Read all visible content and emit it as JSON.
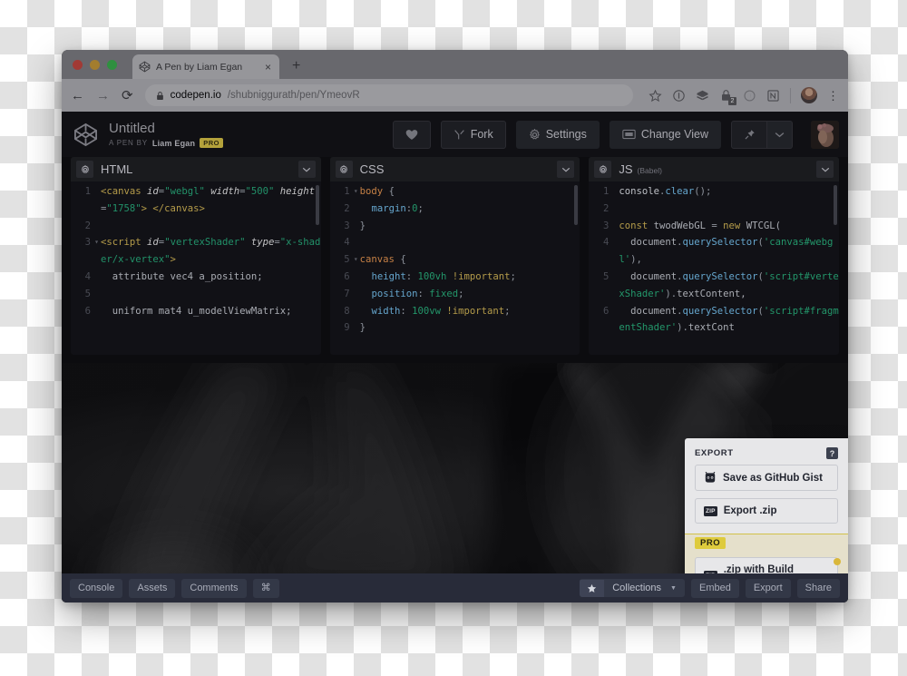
{
  "browser": {
    "tab": {
      "title": "A Pen by Liam Egan",
      "favicon": "codepen-icon",
      "close": "×"
    },
    "new_tab": "+",
    "nav": {
      "back": "←",
      "forward": "→",
      "reload": "⟳"
    },
    "address": {
      "host": "codepen.io",
      "path": "/shubniggurath/pen/YmeovR",
      "lock": "lock-icon"
    },
    "toolbar_icons": [
      "star-icon",
      "info-icon",
      "layers-icon",
      "lastpass-icon",
      "moon-icon",
      "notion-icon"
    ],
    "extension_badge": "2",
    "kebab": "⋮"
  },
  "pen": {
    "logo": "codepen-logo",
    "title": "Untitled",
    "byline": "A PEN BY",
    "author": "Liam Egan",
    "pro_tag": "PRO",
    "actions": {
      "love": "♥",
      "fork": "Fork",
      "settings": "Settings",
      "change_view": "Change View",
      "pin": "pin-icon",
      "pin_caret": "⌄"
    }
  },
  "editors": [
    {
      "name": "HTML",
      "preprocessor": "",
      "gear": "gear-icon",
      "caret": "⌄",
      "lines": [
        {
          "num": "1",
          "fold": false,
          "parts": [
            {
              "t": "tag",
              "s": "<canvas "
            },
            {
              "t": "attr",
              "s": "id"
            },
            {
              "t": "punc",
              "s": "="
            },
            {
              "t": "str",
              "s": "\"webgl\""
            },
            {
              "t": "plain",
              "s": " "
            },
            {
              "t": "attr",
              "s": "width"
            },
            {
              "t": "punc",
              "s": "="
            },
            {
              "t": "str",
              "s": "\"500\""
            },
            {
              "t": "plain",
              "s": " "
            },
            {
              "t": "attr",
              "s": "height"
            },
            {
              "t": "punc",
              "s": "="
            },
            {
              "t": "str",
              "s": "\"1758\""
            },
            {
              "t": "tag",
              "s": "> </canvas>"
            }
          ]
        },
        {
          "num": "2",
          "fold": false,
          "parts": []
        },
        {
          "num": "3",
          "fold": true,
          "parts": [
            {
              "t": "tag",
              "s": "<script "
            },
            {
              "t": "attr",
              "s": "id"
            },
            {
              "t": "punc",
              "s": "="
            },
            {
              "t": "str",
              "s": "\"vertexShader\""
            },
            {
              "t": "plain",
              "s": " "
            },
            {
              "t": "attr",
              "s": "type"
            },
            {
              "t": "punc",
              "s": "="
            },
            {
              "t": "str",
              "s": "\"x-shader/x-vertex\""
            },
            {
              "t": "tag",
              "s": ">"
            }
          ]
        },
        {
          "num": "4",
          "fold": false,
          "parts": [
            {
              "t": "plain",
              "s": "  attribute vec4 a_position;"
            }
          ]
        },
        {
          "num": "5",
          "fold": false,
          "parts": []
        },
        {
          "num": "6",
          "fold": false,
          "parts": [
            {
              "t": "plain",
              "s": "  uniform mat4 u_modelViewMatrix;"
            }
          ]
        }
      ]
    },
    {
      "name": "CSS",
      "preprocessor": "",
      "gear": "gear-icon",
      "caret": "⌄",
      "lines": [
        {
          "num": "1",
          "fold": true,
          "parts": [
            {
              "t": "sel",
              "s": "body"
            },
            {
              "t": "punc",
              "s": " {"
            }
          ]
        },
        {
          "num": "2",
          "fold": false,
          "parts": [
            {
              "t": "prop",
              "s": "  margin"
            },
            {
              "t": "punc",
              "s": ":"
            },
            {
              "t": "val",
              "s": "0"
            },
            {
              "t": "punc",
              "s": ";"
            }
          ]
        },
        {
          "num": "3",
          "fold": false,
          "parts": [
            {
              "t": "punc",
              "s": "}"
            }
          ]
        },
        {
          "num": "4",
          "fold": false,
          "parts": []
        },
        {
          "num": "5",
          "fold": true,
          "parts": [
            {
              "t": "sel",
              "s": "canvas"
            },
            {
              "t": "punc",
              "s": " {"
            }
          ]
        },
        {
          "num": "6",
          "fold": false,
          "parts": [
            {
              "t": "prop",
              "s": "  height"
            },
            {
              "t": "punc",
              "s": ": "
            },
            {
              "t": "val",
              "s": "100vh"
            },
            {
              "t": "plain",
              "s": " "
            },
            {
              "t": "imp",
              "s": "!important"
            },
            {
              "t": "punc",
              "s": ";"
            }
          ]
        },
        {
          "num": "7",
          "fold": false,
          "parts": [
            {
              "t": "prop",
              "s": "  position"
            },
            {
              "t": "punc",
              "s": ": "
            },
            {
              "t": "val",
              "s": "fixed"
            },
            {
              "t": "punc",
              "s": ";"
            }
          ]
        },
        {
          "num": "8",
          "fold": false,
          "parts": [
            {
              "t": "prop",
              "s": "  width"
            },
            {
              "t": "punc",
              "s": ": "
            },
            {
              "t": "val",
              "s": "100vw"
            },
            {
              "t": "plain",
              "s": " "
            },
            {
              "t": "imp",
              "s": "!important"
            },
            {
              "t": "punc",
              "s": ";"
            }
          ]
        },
        {
          "num": "9",
          "fold": false,
          "parts": [
            {
              "t": "punc",
              "s": "}"
            }
          ]
        }
      ]
    },
    {
      "name": "JS",
      "preprocessor": "(Babel)",
      "gear": "gear-icon",
      "caret": "⌄",
      "lines": [
        {
          "num": "1",
          "fold": false,
          "parts": [
            {
              "t": "var",
              "s": "console"
            },
            {
              "t": "punc",
              "s": "."
            },
            {
              "t": "fn",
              "s": "clear"
            },
            {
              "t": "punc",
              "s": "();"
            }
          ]
        },
        {
          "num": "2",
          "fold": false,
          "parts": []
        },
        {
          "num": "3",
          "fold": false,
          "parts": [
            {
              "t": "kw",
              "s": "const"
            },
            {
              "t": "plain",
              "s": " twodWebGL "
            },
            {
              "t": "punc",
              "s": "= "
            },
            {
              "t": "kw",
              "s": "new"
            },
            {
              "t": "plain",
              "s": " WTCGL("
            }
          ]
        },
        {
          "num": "4",
          "fold": false,
          "parts": [
            {
              "t": "plain",
              "s": "  document"
            },
            {
              "t": "punc",
              "s": "."
            },
            {
              "t": "fn",
              "s": "querySelector"
            },
            {
              "t": "punc",
              "s": "("
            },
            {
              "t": "val",
              "s": "'canvas#webgl'"
            },
            {
              "t": "punc",
              "s": "),"
            }
          ]
        },
        {
          "num": "5",
          "fold": false,
          "parts": [
            {
              "t": "plain",
              "s": "  document"
            },
            {
              "t": "punc",
              "s": "."
            },
            {
              "t": "fn",
              "s": "querySelector"
            },
            {
              "t": "punc",
              "s": "("
            },
            {
              "t": "val",
              "s": "'script#vertexShader'"
            },
            {
              "t": "punc",
              "s": ")."
            },
            {
              "t": "plain",
              "s": "textContent,"
            }
          ]
        },
        {
          "num": "6",
          "fold": false,
          "parts": [
            {
              "t": "plain",
              "s": "  document"
            },
            {
              "t": "punc",
              "s": "."
            },
            {
              "t": "fn",
              "s": "querySelector"
            },
            {
              "t": "punc",
              "s": "("
            },
            {
              "t": "val",
              "s": "'script#fragmentShader'"
            },
            {
              "t": "punc",
              "s": ")."
            },
            {
              "t": "plain",
              "s": "textCont"
            }
          ]
        }
      ]
    }
  ],
  "export_popover": {
    "title": "EXPORT",
    "help": "?",
    "items": [
      {
        "label": "Save as GitHub Gist",
        "icon": "github-icon"
      },
      {
        "label": "Export .zip",
        "icon": "zip-icon"
      }
    ],
    "pro_label": "PRO",
    "pro_item": {
      "label": ".zip with Build Process",
      "icon": "zip-icon"
    }
  },
  "bottom_bar": {
    "left": [
      {
        "label": "Console",
        "name": "console-button"
      },
      {
        "label": "Assets",
        "name": "assets-button"
      },
      {
        "label": "Comments",
        "name": "comments-button"
      },
      {
        "label": "⌘",
        "name": "shortcuts-button"
      }
    ],
    "collections": {
      "star": "★",
      "label": "Collections",
      "caret": "▼"
    },
    "right": [
      {
        "label": "Embed",
        "name": "embed-button"
      },
      {
        "label": "Export",
        "name": "export-button"
      },
      {
        "label": "Share",
        "name": "share-button"
      }
    ]
  },
  "colors": {
    "pro_yellow": "#f5e03c",
    "app_bg": "#060607",
    "editor_bg": "#0c0c0f",
    "bottom_bar": "#262a37"
  }
}
